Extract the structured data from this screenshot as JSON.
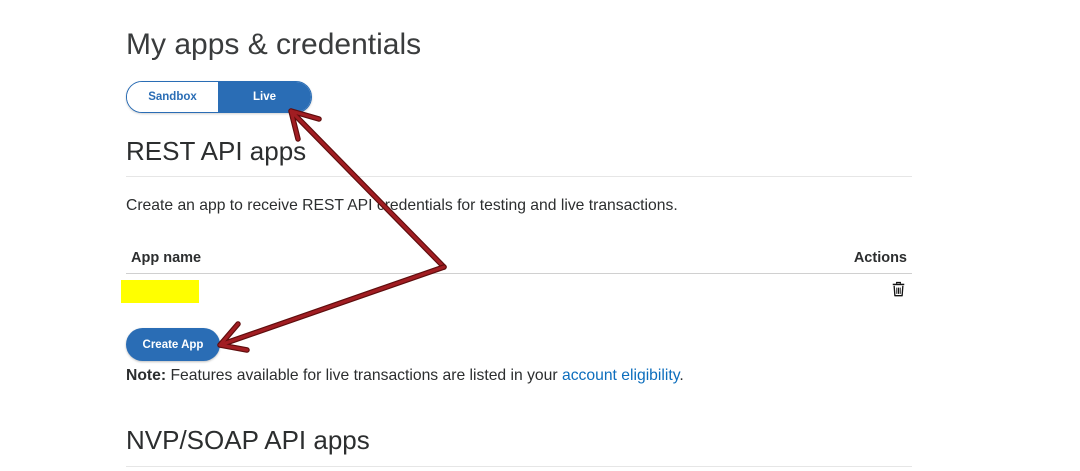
{
  "page": {
    "title": "My apps & credentials"
  },
  "environment_toggle": {
    "options": [
      "Sandbox",
      "Live"
    ],
    "selected_index": 1
  },
  "rest_api_apps": {
    "heading": "REST API apps",
    "description": "Create an app to receive REST API credentials for testing and live transactions.",
    "table": {
      "columns": [
        "App name",
        "Actions"
      ],
      "rows": [
        {
          "app_name_redacted": true,
          "action_icon": "trash-icon"
        }
      ]
    },
    "create_button": {
      "label": "Create App"
    },
    "note": {
      "label": "Note:",
      "text": "Features available for live transactions are listed in your",
      "link_text": "account eligibility",
      "suffix": "."
    }
  },
  "nvp_soap_apps": {
    "heading": "NVP/SOAP API apps"
  },
  "colors": {
    "accent": "#2a6db5",
    "link": "#0d6ebd",
    "text": "#2c2e2f",
    "annotation_arrow": "#a11d22",
    "redaction_highlight": "#ffff00"
  }
}
